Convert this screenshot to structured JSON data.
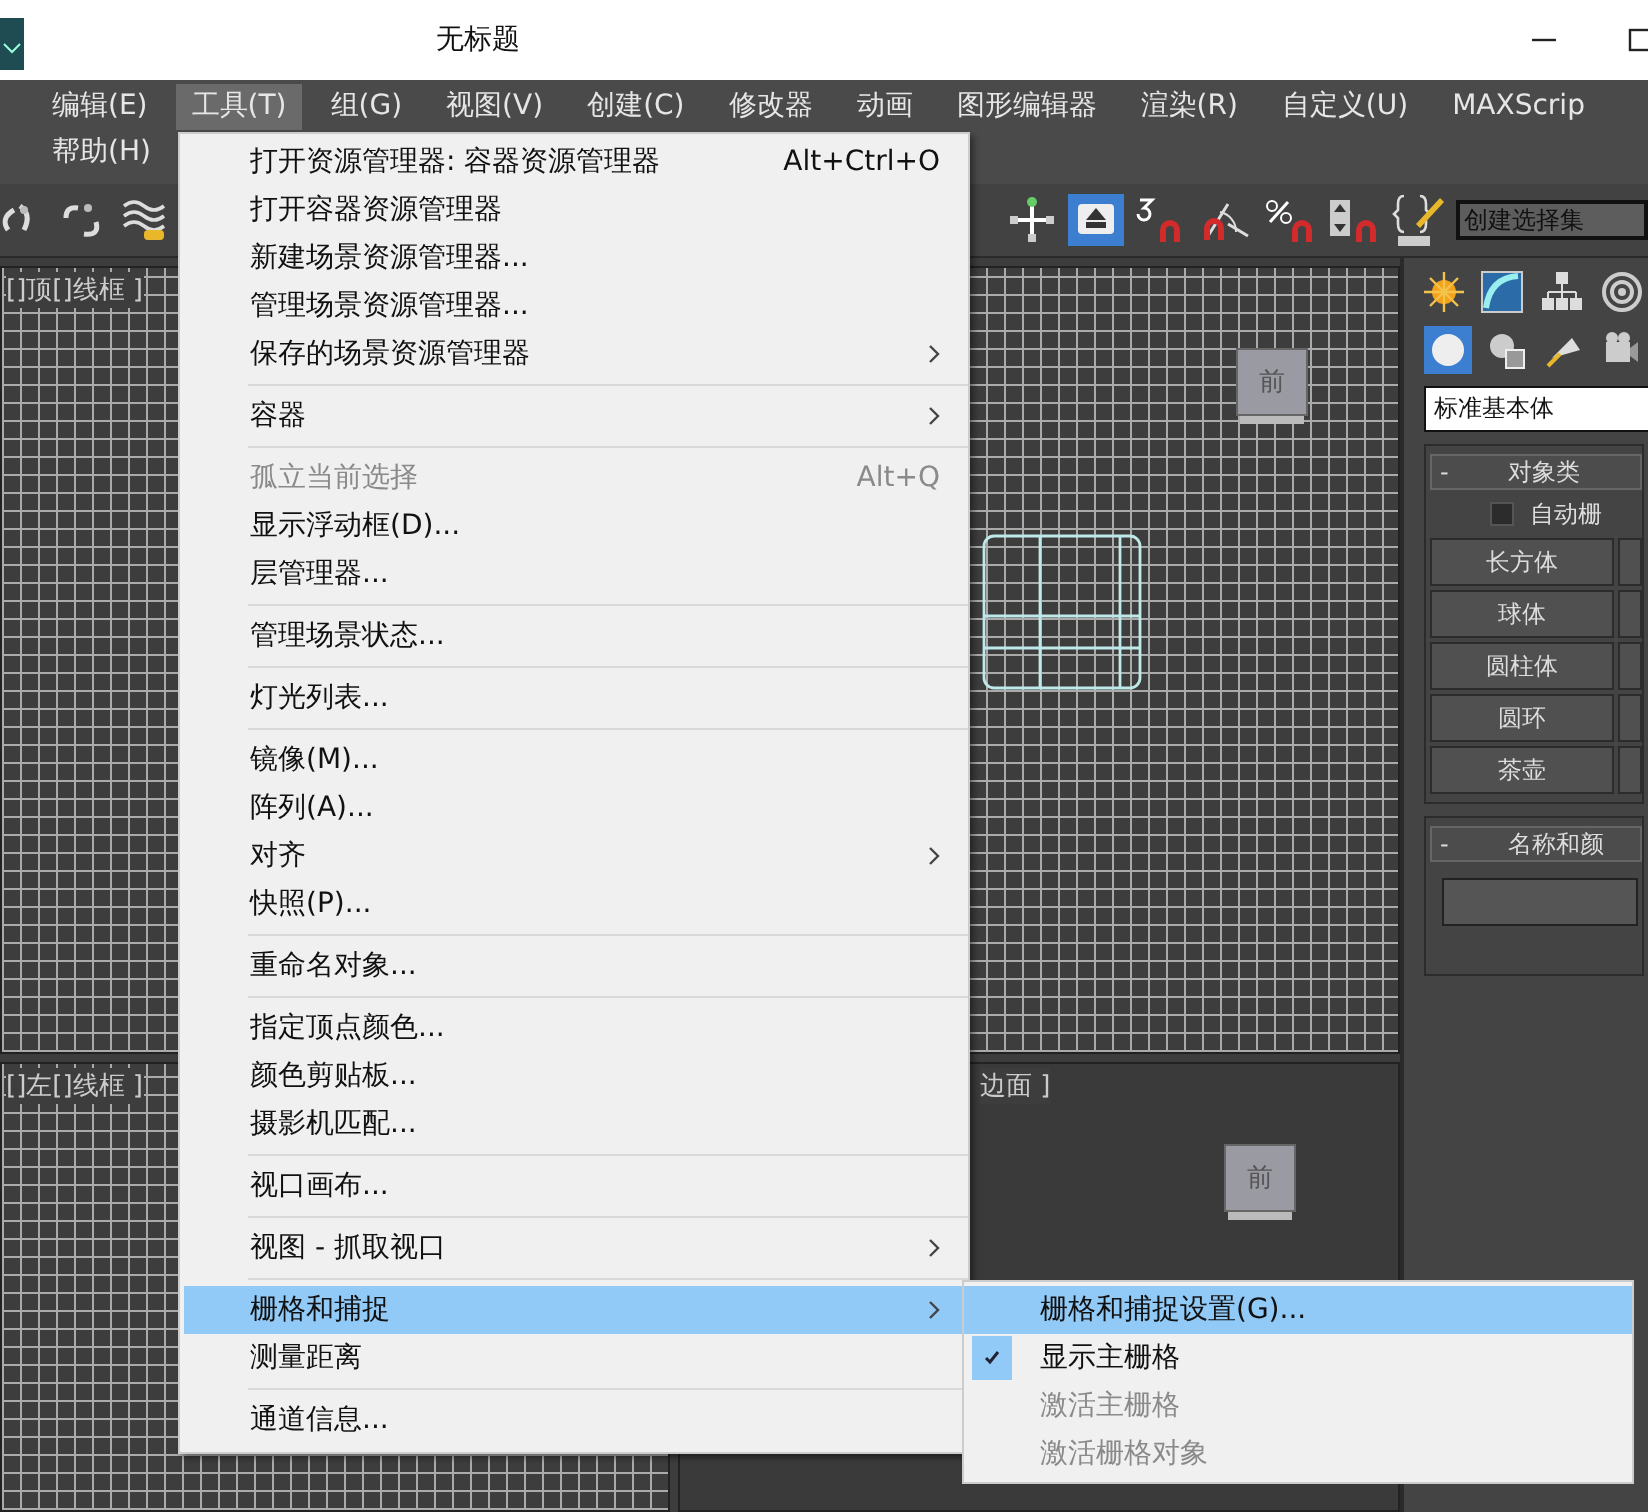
{
  "window": {
    "title": "无标题"
  },
  "menubar": [
    {
      "label": "编辑(E)",
      "selected": false
    },
    {
      "label": "工具(T)",
      "selected": true
    },
    {
      "label": "组(G)",
      "selected": false
    },
    {
      "label": "视图(V)",
      "selected": false
    },
    {
      "label": "创建(C)",
      "selected": false
    },
    {
      "label": "修改器",
      "selected": false
    },
    {
      "label": "动画",
      "selected": false
    },
    {
      "label": "图形编辑器",
      "selected": false
    },
    {
      "label": "渲染(R)",
      "selected": false
    },
    {
      "label": "自定义(U)",
      "selected": false
    },
    {
      "label": "MAXScrip",
      "selected": false
    },
    {
      "label": "帮助(H)",
      "selected": false
    }
  ],
  "toolbar": {
    "selection_set": "创建选择集"
  },
  "viewports": [
    {
      "label": "[]顶[]线框 ]"
    },
    {
      "cube_label": "前"
    },
    {
      "label": "[]左[]线框 ]"
    },
    {
      "label": "边面 ]",
      "cube_label": "前"
    }
  ],
  "tools_menu": {
    "groups": [
      [
        {
          "label": "打开资源管理器: 容器资源管理器",
          "shortcut": "Alt+Ctrl+O",
          "submenu": false,
          "disabled": false,
          "selected": false
        },
        {
          "label": "打开容器资源管理器",
          "submenu": false,
          "disabled": false,
          "selected": false
        },
        {
          "label": "新建场景资源管理器...",
          "submenu": false,
          "disabled": false,
          "selected": false
        },
        {
          "label": "管理场景资源管理器...",
          "submenu": false,
          "disabled": false,
          "selected": false
        },
        {
          "label": "保存的场景资源管理器",
          "submenu": true,
          "disabled": false,
          "selected": false
        }
      ],
      [
        {
          "label": "容器",
          "submenu": true,
          "disabled": false,
          "selected": false
        }
      ],
      [
        {
          "label": "孤立当前选择",
          "shortcut": "Alt+Q",
          "submenu": false,
          "disabled": true,
          "selected": false
        },
        {
          "label": "显示浮动框(D)...",
          "submenu": false,
          "disabled": false,
          "selected": false
        },
        {
          "label": "层管理器...",
          "submenu": false,
          "disabled": false,
          "selected": false
        }
      ],
      [
        {
          "label": "管理场景状态...",
          "submenu": false,
          "disabled": false,
          "selected": false
        }
      ],
      [
        {
          "label": "灯光列表...",
          "submenu": false,
          "disabled": false,
          "selected": false
        }
      ],
      [
        {
          "label": "镜像(M)...",
          "submenu": false,
          "disabled": false,
          "selected": false
        },
        {
          "label": "阵列(A)...",
          "submenu": false,
          "disabled": false,
          "selected": false
        },
        {
          "label": "对齐",
          "submenu": true,
          "disabled": false,
          "selected": false
        },
        {
          "label": "快照(P)...",
          "submenu": false,
          "disabled": false,
          "selected": false
        }
      ],
      [
        {
          "label": "重命名对象...",
          "submenu": false,
          "disabled": false,
          "selected": false
        }
      ],
      [
        {
          "label": "指定顶点颜色...",
          "submenu": false,
          "disabled": false,
          "selected": false
        },
        {
          "label": "颜色剪贴板...",
          "submenu": false,
          "disabled": false,
          "selected": false
        },
        {
          "label": "摄影机匹配...",
          "submenu": false,
          "disabled": false,
          "selected": false
        }
      ],
      [
        {
          "label": "视口画布...",
          "submenu": false,
          "disabled": false,
          "selected": false
        }
      ],
      [
        {
          "label": "视图 - 抓取视口",
          "submenu": true,
          "disabled": false,
          "selected": false
        }
      ],
      [
        {
          "label": "栅格和捕捉",
          "submenu": true,
          "disabled": false,
          "selected": true
        },
        {
          "label": "测量距离",
          "submenu": false,
          "disabled": false,
          "selected": false
        }
      ],
      [
        {
          "label": "通道信息...",
          "submenu": false,
          "disabled": false,
          "selected": false
        }
      ]
    ]
  },
  "grid_submenu": {
    "items": [
      {
        "label": "栅格和捕捉设置(G)...",
        "selected": true,
        "checked": false,
        "disabled": false
      },
      {
        "label": "显示主栅格",
        "selected": false,
        "checked": true,
        "disabled": false
      },
      {
        "label": "激活主栅格",
        "selected": false,
        "checked": false,
        "disabled": true
      },
      {
        "label": "激活栅格对象",
        "selected": false,
        "checked": false,
        "disabled": true
      }
    ]
  },
  "command_panel": {
    "category": "标准基本体",
    "rollouts": [
      {
        "sign": "-",
        "title": "对象类",
        "auto_grid": {
          "label": "自动栅",
          "checked": false
        },
        "buttons": [
          "长方体",
          "球体",
          "圆柱体",
          "圆环",
          "茶壶"
        ]
      },
      {
        "sign": "-",
        "title": "名称和颜",
        "name_field": true
      }
    ]
  }
}
